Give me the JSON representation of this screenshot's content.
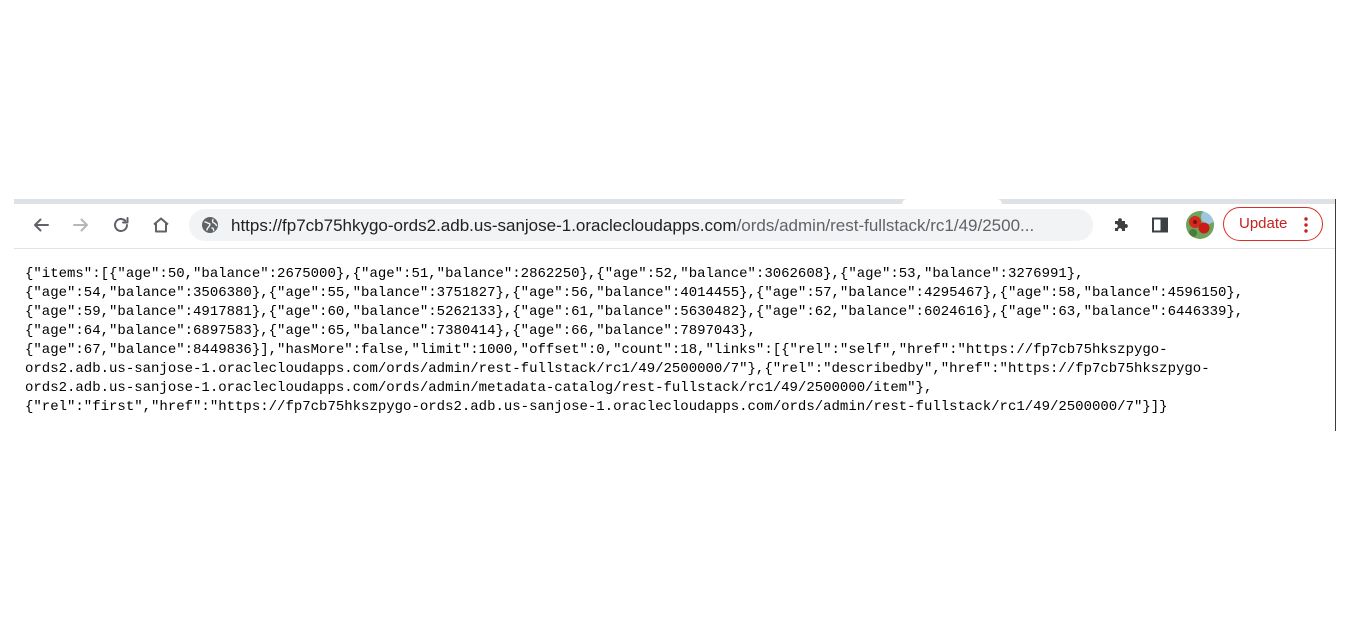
{
  "browser": {
    "url_host": "https://fp7cb75hkygo-ords2.adb.us-sanjose-1.oraclecloudapps.com",
    "url_path": "/ords/admin/rest-fullstack/rc1/49/2500...",
    "update_label": "Update",
    "icons": {
      "back": "back-arrow-icon",
      "forward": "forward-arrow-icon",
      "reload": "reload-icon",
      "home": "home-icon",
      "site_info": "globe-icon",
      "extensions": "puzzle-icon",
      "side_panel": "side-panel-icon",
      "profile": "avatar",
      "menu": "more-vertical-icon"
    },
    "colors": {
      "accent_red": "#d93025",
      "omnibox_bg": "#f1f3f4"
    }
  },
  "page": {
    "lines": [
      "{\"items\":[{\"age\":50,\"balance\":2675000},{\"age\":51,\"balance\":2862250},{\"age\":52,\"balance\":3062608},{\"age\":53,\"balance\":3276991},",
      "{\"age\":54,\"balance\":3506380},{\"age\":55,\"balance\":3751827},{\"age\":56,\"balance\":4014455},{\"age\":57,\"balance\":4295467},{\"age\":58,\"balance\":4596150},",
      "{\"age\":59,\"balance\":4917881},{\"age\":60,\"balance\":5262133},{\"age\":61,\"balance\":5630482},{\"age\":62,\"balance\":6024616},{\"age\":63,\"balance\":6446339},",
      "{\"age\":64,\"balance\":6897583},{\"age\":65,\"balance\":7380414},{\"age\":66,\"balance\":7897043},",
      "{\"age\":67,\"balance\":8449836}],\"hasMore\":false,\"limit\":1000,\"offset\":0,\"count\":18,\"links\":[{\"rel\":\"self\",\"href\":\"https://fp7cb75hkszpygo-",
      "ords2.adb.us-sanjose-1.oraclecloudapps.com/ords/admin/rest-fullstack/rc1/49/2500000/7\"},{\"rel\":\"describedby\",\"href\":\"https://fp7cb75hkszpygo-",
      "ords2.adb.us-sanjose-1.oraclecloudapps.com/ords/admin/metadata-catalog/rest-fullstack/rc1/49/2500000/item\"},",
      "{\"rel\":\"first\",\"href\":\"https://fp7cb75hkszpygo-ords2.adb.us-sanjose-1.oraclecloudapps.com/ords/admin/rest-fullstack/rc1/49/2500000/7\"}]}"
    ]
  }
}
